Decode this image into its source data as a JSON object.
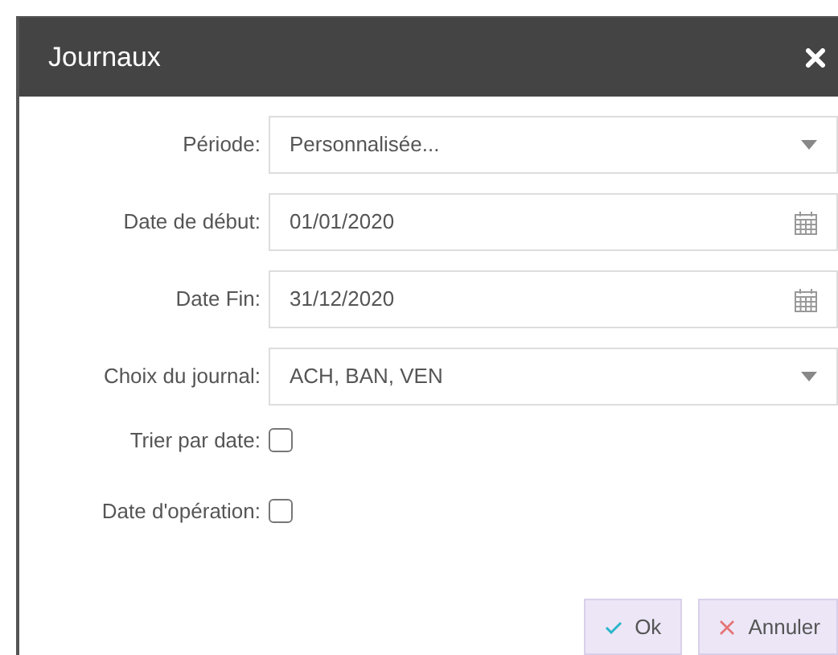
{
  "window": {
    "title": "Journaux"
  },
  "fields": [
    {
      "label": "Période:",
      "kind": "select",
      "value": "Personnalisée..."
    },
    {
      "label": "Date de début:",
      "kind": "date",
      "value": "01/01/2020"
    },
    {
      "label": "Date Fin:",
      "kind": "date",
      "value": "31/12/2020"
    },
    {
      "label": "Choix du journal:",
      "kind": "select",
      "value": "ACH, BAN, VEN"
    }
  ],
  "checkboxes": [
    {
      "label": "Trier par date:",
      "checked": false
    },
    {
      "label": "Date d'opération:",
      "checked": false
    }
  ],
  "buttons": [
    {
      "label": "Ok",
      "kind": "ok"
    },
    {
      "label": "Annuler",
      "kind": "cancel"
    }
  ]
}
